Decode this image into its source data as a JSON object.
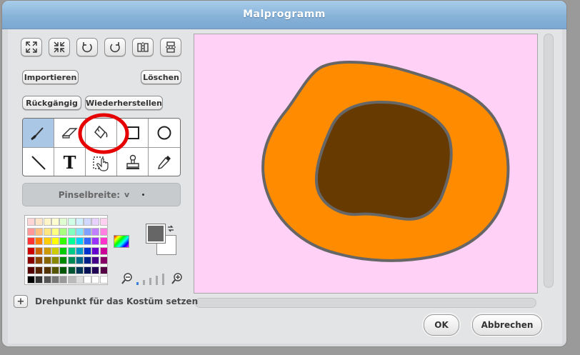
{
  "window": {
    "title": "Malprogramm"
  },
  "buttons": {
    "import": "Importieren",
    "clear": "Löschen",
    "undo": "Rückgängig",
    "redo": "Wiederherstellen",
    "ok": "OK",
    "cancel": "Abbrechen"
  },
  "toolbar_icons": [
    "grow-icon",
    "shrink-icon",
    "rotate-left-icon",
    "rotate-right-icon",
    "flip-horizontal-icon",
    "flip-vertical-icon"
  ],
  "tools": [
    {
      "name": "paintbrush-tool",
      "selected": true
    },
    {
      "name": "eraser-tool"
    },
    {
      "name": "fill-bucket-tool",
      "highlighted": true
    },
    {
      "name": "rectangle-tool"
    },
    {
      "name": "ellipse-tool"
    },
    {
      "name": "line-tool"
    },
    {
      "name": "text-tool",
      "glyph": "T"
    },
    {
      "name": "select-tool"
    },
    {
      "name": "stamp-tool"
    },
    {
      "name": "eyedropper-tool"
    }
  ],
  "brush": {
    "label": "Pinselbreite:",
    "caret": "v"
  },
  "colors": {
    "foreground": "#666666",
    "background": "#ffffff",
    "canvas": "#ffd1f6",
    "outer_blob": "#ff8c00",
    "inner_blob": "#663a00",
    "outline": "#666666",
    "highlight_circle": "#e60000"
  },
  "palette": [
    [
      "#ffd6d6",
      "#ffe6c8",
      "#fff5c8",
      "#ffffd0",
      "#e0ffd0",
      "#d0ffe8",
      "#d0f0ff",
      "#d0d8ff",
      "#e8d0ff",
      "#ffd0f0"
    ],
    [
      "#ff9999",
      "#ffc080",
      "#ffe680",
      "#ffff80",
      "#a8ff80",
      "#80ffc0",
      "#80e0ff",
      "#80a0ff",
      "#c080ff",
      "#ff80e0"
    ],
    [
      "#ff3333",
      "#ff8000",
      "#ffcc00",
      "#ffff00",
      "#33ff00",
      "#00ff99",
      "#00ccff",
      "#3366ff",
      "#9933ff",
      "#ff33cc"
    ],
    [
      "#cc0000",
      "#cc6600",
      "#cc9900",
      "#cccc00",
      "#00cc00",
      "#00cc88",
      "#0099cc",
      "#0033cc",
      "#6600cc",
      "#cc0099"
    ],
    [
      "#880000",
      "#884400",
      "#886600",
      "#888800",
      "#008800",
      "#008855",
      "#006688",
      "#002288",
      "#440088",
      "#880066"
    ],
    [
      "#550000",
      "#552200",
      "#553300",
      "#555500",
      "#005500",
      "#005533",
      "#003355",
      "#001155",
      "#220055",
      "#550044"
    ],
    [
      "#000000",
      "#333333",
      "#555555",
      "#777777",
      "#999999",
      "#bbbbbb",
      "#dddddd",
      "#ffffff",
      "#ffffff",
      "#ffffff"
    ]
  ],
  "pivot": {
    "plus": "+",
    "label": "Drehpunkt für das Kostüm setzen"
  },
  "zoom": {
    "out": "zoom-out-icon",
    "in": "zoom-in-icon"
  }
}
